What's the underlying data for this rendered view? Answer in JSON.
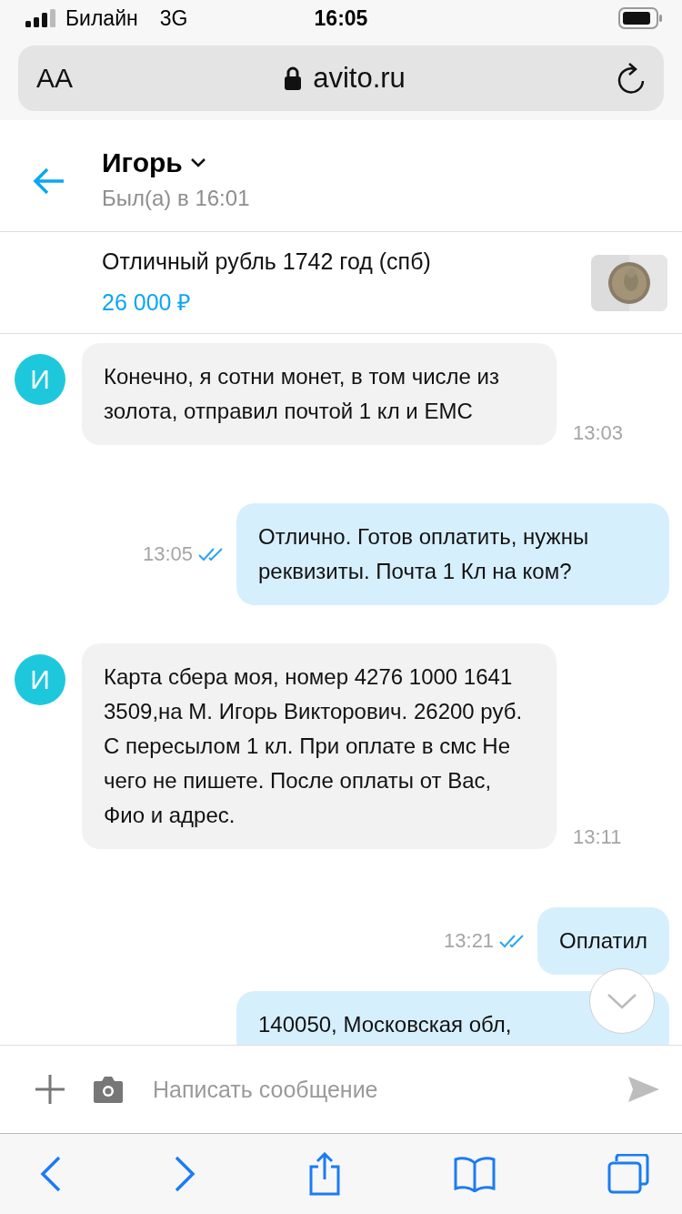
{
  "status_bar": {
    "carrier": "Билайн",
    "network": "3G",
    "time": "16:05"
  },
  "browser_bar": {
    "text_size": "AA",
    "url": "avito.ru"
  },
  "chat_header": {
    "name": "Игорь",
    "last_seen": "Был(а) в 16:01"
  },
  "listing": {
    "title": "Отличный рубль 1742 год (спб)",
    "price": "26 000 ₽"
  },
  "messages": [
    {
      "kind": "incoming",
      "avatar": "И",
      "text": "Конечно, я сотни монет, в том числе из золота, отправил почтой 1 кл и ЕМС",
      "time": "13:03"
    },
    {
      "kind": "outgoing",
      "text": "Отлично. Готов оплатить, нужны реквизиты. Почта 1 Кл на ком?",
      "time": "13:05",
      "read": true
    },
    {
      "kind": "incoming",
      "avatar": "И",
      "text": "Карта сбера моя, номер 4276 1000 1641 3509,на М. Игорь Викторович. 26200 руб. С пересылом 1 кл. При оплате в смс Не чего не пишете. После оплаты от Вас, Фио и адрес.",
      "time": "13:11"
    },
    {
      "kind": "outgoing",
      "text": "Оплатил",
      "time": "13:21",
      "read": true
    },
    {
      "kind": "outgoing",
      "text": "140050, Московская обл,"
    }
  ],
  "composer": {
    "placeholder": "Написать сообщение"
  }
}
